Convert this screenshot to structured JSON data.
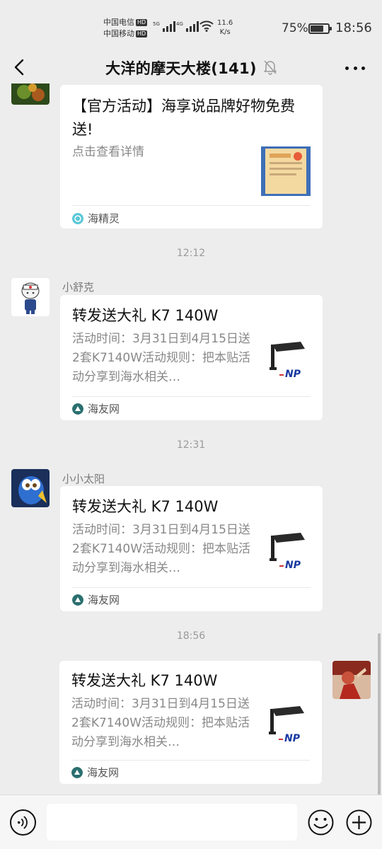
{
  "status_bar": {
    "carrier1": "中国电信",
    "carrier2": "中国移动",
    "hd_label": "HD",
    "signal1_label": "5G",
    "signal2_label": "4G",
    "net_speed_value": "11.6",
    "net_speed_unit": "K/s",
    "battery_percent": "75%",
    "battery_level": 0.75,
    "time": "18:56"
  },
  "header": {
    "title": "大洋的摩天大楼(141)",
    "icons": [
      "back-arrow-icon",
      "mute-bell-icon",
      "more-dots-icon"
    ]
  },
  "messages": {
    "m1": {
      "title": "【官方活动】海享说品牌好物免费送!",
      "desc": "点击查看详情",
      "source": "海精灵"
    },
    "t1": "12:12",
    "m2": {
      "sender": "小舒克",
      "title": "转发送大礼 K7 140W",
      "desc": "活动时间：3月31日到4月15日送2套K7140W活动规则：把本贴活动分享到海水相关…",
      "source": "海友网"
    },
    "t2": "12:31",
    "m3": {
      "sender": "小小太阳",
      "title": "转发送大礼 K7 140W",
      "desc": "活动时间：3月31日到4月15日送2套K7140W活动规则：把本贴活动分享到海水相关…",
      "source": "海友网"
    },
    "t3": "18:56",
    "m4": {
      "title": "转发送大礼 K7 140W",
      "desc": "活动时间：3月31日到4月15日送2套K7140W活动规则：把本贴活动分享到海水相关…",
      "source": "海友网"
    }
  },
  "input_bar": {
    "placeholder": "",
    "icons": [
      "voice-icon",
      "emoji-icon",
      "plus-icon"
    ]
  },
  "colors": {
    "background": "#ededed",
    "card": "#ffffff",
    "text": "#111111",
    "muted": "#888888"
  }
}
